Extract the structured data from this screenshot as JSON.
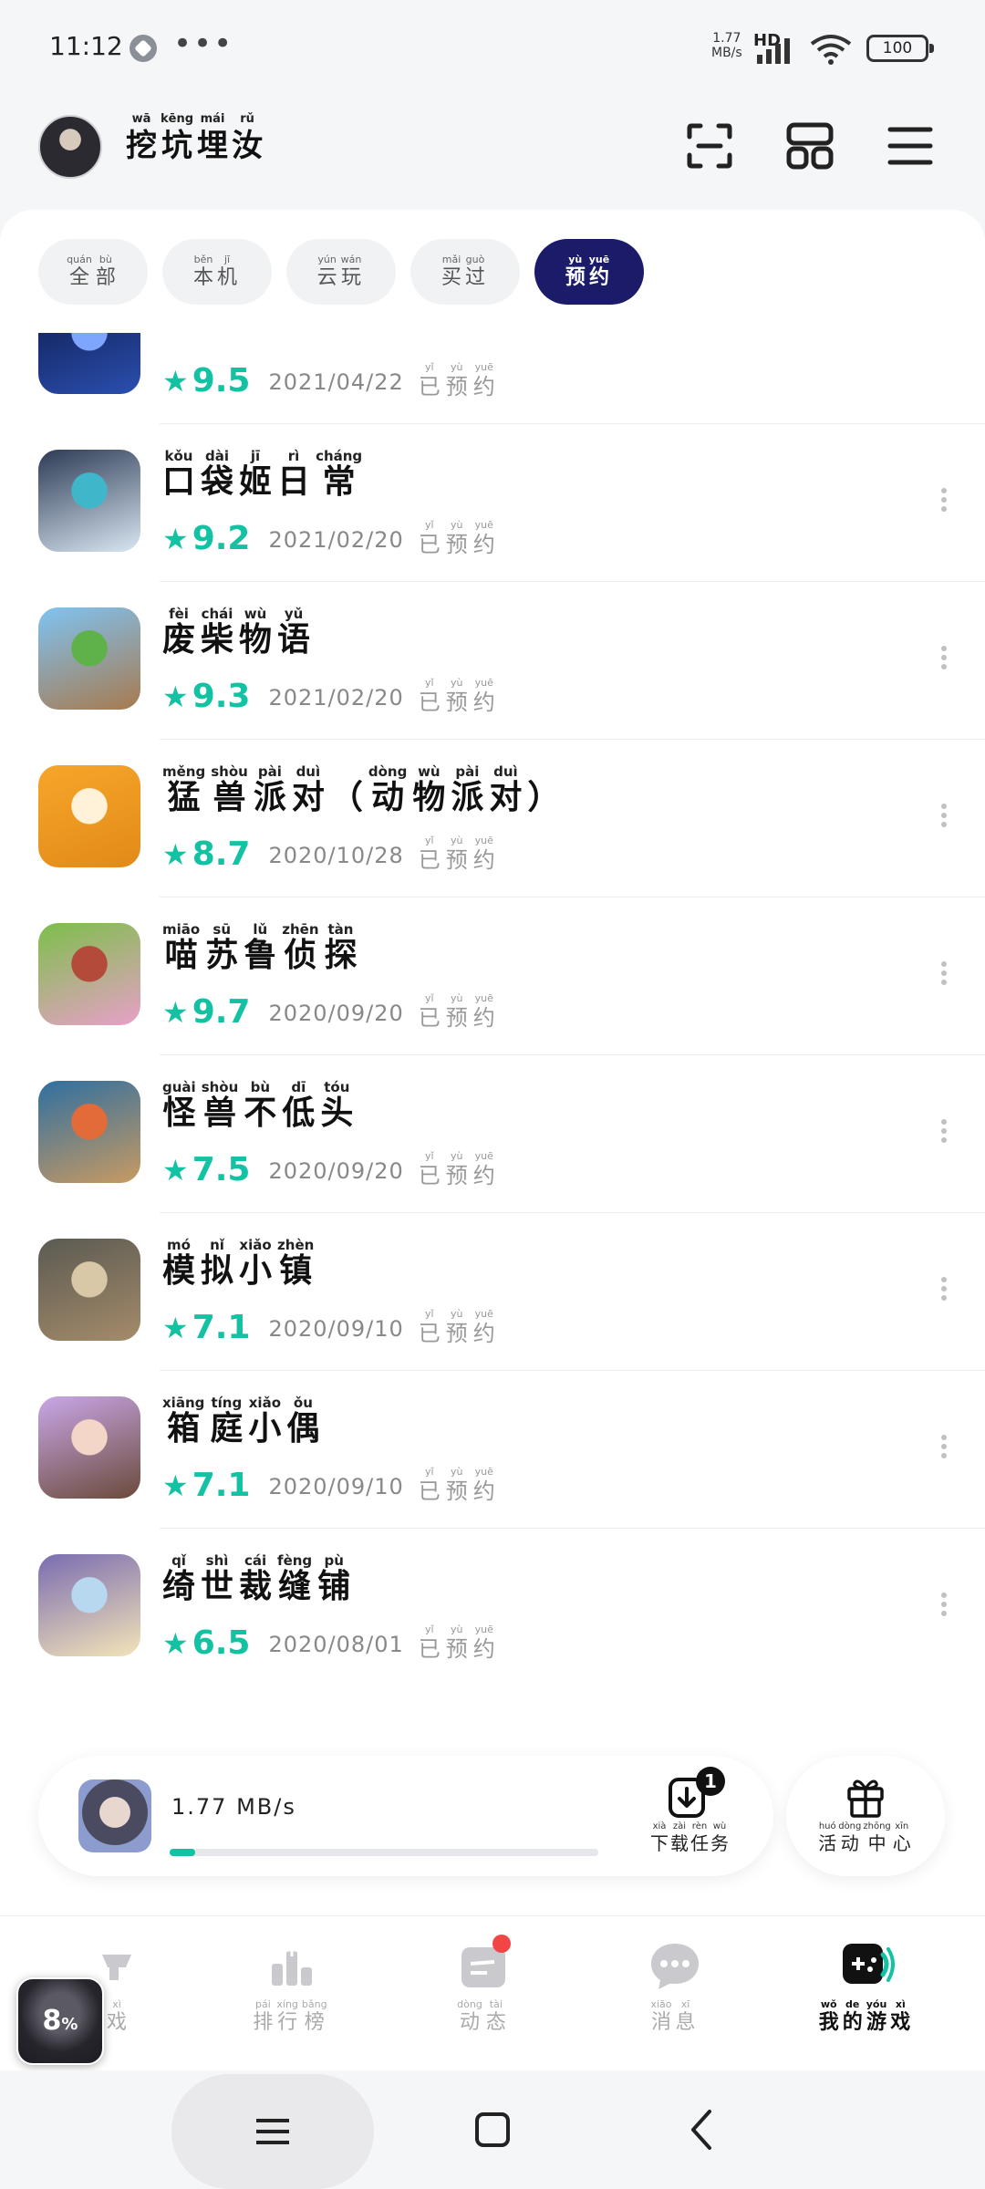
{
  "status": {
    "time": "11:12",
    "dots": "•••",
    "net_speed": "1.77",
    "net_unit": "MB/s",
    "hd": "HD",
    "battery": "100"
  },
  "header": {
    "username": [
      {
        "py": "wā",
        "hz": "挖"
      },
      {
        "py": "kēng",
        "hz": "坑"
      },
      {
        "py": "mái",
        "hz": "埋"
      },
      {
        "py": "rǔ",
        "hz": "汝"
      }
    ]
  },
  "tabs": [
    {
      "label": [
        {
          "py": "quán",
          "hz": "全"
        },
        {
          "py": "bù",
          "hz": "部"
        }
      ],
      "active": false
    },
    {
      "label": [
        {
          "py": "běn",
          "hz": "本"
        },
        {
          "py": "jī",
          "hz": "机"
        }
      ],
      "active": false
    },
    {
      "label": [
        {
          "py": "yún",
          "hz": "云"
        },
        {
          "py": "wán",
          "hz": "玩"
        }
      ],
      "active": false
    },
    {
      "label": [
        {
          "py": "mǎi",
          "hz": "买"
        },
        {
          "py": "guò",
          "hz": "过"
        }
      ],
      "active": false
    },
    {
      "label": [
        {
          "py": "yù",
          "hz": "预"
        },
        {
          "py": "yuē",
          "hz": "约"
        }
      ],
      "active": true
    }
  ],
  "reserved_label": [
    {
      "py": "yǐ",
      "hz": "已"
    },
    {
      "py": "yù",
      "hz": "预"
    },
    {
      "py": "yuē",
      "hz": "约"
    }
  ],
  "games": [
    {
      "title": [],
      "rating": "9.5",
      "date": "2021/04/22",
      "colors": [
        "#0c1a4a",
        "#2b4fb0",
        "#7fa6ff"
      ]
    },
    {
      "title": [
        {
          "py": "kǒu",
          "hz": "口"
        },
        {
          "py": "dài",
          "hz": "袋"
        },
        {
          "py": "jī",
          "hz": "姬"
        },
        {
          "py": "rì",
          "hz": "日"
        },
        {
          "py": "cháng",
          "hz": "常"
        }
      ],
      "rating": "9.2",
      "date": "2021/02/20",
      "colors": [
        "#2d3b55",
        "#d9e6f2",
        "#3fb6c9"
      ]
    },
    {
      "title": [
        {
          "py": "fèi",
          "hz": "废"
        },
        {
          "py": "chái",
          "hz": "柴"
        },
        {
          "py": "wù",
          "hz": "物"
        },
        {
          "py": "yǔ",
          "hz": "语"
        }
      ],
      "rating": "9.3",
      "date": "2021/02/20",
      "colors": [
        "#7fc3f2",
        "#a77a4f",
        "#5fb24a"
      ]
    },
    {
      "title": [
        {
          "py": "měng",
          "hz": "猛"
        },
        {
          "py": "shòu",
          "hz": "兽"
        },
        {
          "py": "pài",
          "hz": "派"
        },
        {
          "py": "duì",
          "hz": "对"
        },
        {
          "py": "",
          "hz": "（"
        },
        {
          "py": "dòng",
          "hz": "动"
        },
        {
          "py": "wù",
          "hz": "物"
        },
        {
          "py": "pài",
          "hz": "派"
        },
        {
          "py": "duì",
          "hz": "对"
        },
        {
          "py": "",
          "hz": "）"
        }
      ],
      "rating": "8.7",
      "date": "2020/10/28",
      "colors": [
        "#f6a62a",
        "#e28a18",
        "#fff2d8"
      ]
    },
    {
      "title": [
        {
          "py": "miāo",
          "hz": "喵"
        },
        {
          "py": "sū",
          "hz": "苏"
        },
        {
          "py": "lǔ",
          "hz": "鲁"
        },
        {
          "py": "zhēn",
          "hz": "侦"
        },
        {
          "py": "tàn",
          "hz": "探"
        }
      ],
      "rating": "9.7",
      "date": "2020/09/20",
      "colors": [
        "#7cbf4a",
        "#e8a0c8",
        "#b34a3a"
      ]
    },
    {
      "title": [
        {
          "py": "guài",
          "hz": "怪"
        },
        {
          "py": "shòu",
          "hz": "兽"
        },
        {
          "py": "bù",
          "hz": "不"
        },
        {
          "py": "dī",
          "hz": "低"
        },
        {
          "py": "tóu",
          "hz": "头"
        }
      ],
      "rating": "7.5",
      "date": "2020/09/20",
      "colors": [
        "#2f6fa0",
        "#c89a62",
        "#e36b3a"
      ]
    },
    {
      "title": [
        {
          "py": "mó",
          "hz": "模"
        },
        {
          "py": "nǐ",
          "hz": "拟"
        },
        {
          "py": "xiǎo",
          "hz": "小"
        },
        {
          "py": "zhèn",
          "hz": "镇"
        }
      ],
      "rating": "7.1",
      "date": "2020/09/10",
      "colors": [
        "#5a5a52",
        "#a58b6a",
        "#d8c8a8"
      ]
    },
    {
      "title": [
        {
          "py": "xiāng",
          "hz": "箱"
        },
        {
          "py": "tíng",
          "hz": "庭"
        },
        {
          "py": "xiǎo",
          "hz": "小"
        },
        {
          "py": "ǒu",
          "hz": "偶"
        }
      ],
      "rating": "7.1",
      "date": "2020/09/10",
      "colors": [
        "#c9a7e8",
        "#6a4a3a",
        "#f3d6c8"
      ]
    },
    {
      "title": [
        {
          "py": "qǐ",
          "hz": "绮"
        },
        {
          "py": "shì",
          "hz": "世"
        },
        {
          "py": "cái",
          "hz": "裁"
        },
        {
          "py": "fèng",
          "hz": "缝"
        },
        {
          "py": "pù",
          "hz": "铺"
        }
      ],
      "rating": "6.5",
      "date": "2020/08/01",
      "colors": [
        "#7a6cb0",
        "#f3e4b8",
        "#b8d8f0"
      ]
    }
  ],
  "download": {
    "speed": "1.77 MB/s",
    "progress_fraction": 0.06,
    "task_badge": "1",
    "task_label": [
      {
        "py": "xià",
        "hz": "下"
      },
      {
        "py": "zài",
        "hz": "载"
      },
      {
        "py": "rèn",
        "hz": "任"
      },
      {
        "py": "wù",
        "hz": "务"
      }
    ],
    "event_label": [
      {
        "py": "huó",
        "hz": "活"
      },
      {
        "py": "dòng",
        "hz": "动"
      },
      {
        "py": "zhōng",
        "hz": "中"
      },
      {
        "py": "xīn",
        "hz": "心"
      }
    ]
  },
  "nav": [
    {
      "name": "games",
      "label": [
        {
          "py": "xì",
          "hz": "戏"
        }
      ],
      "active": false
    },
    {
      "name": "rank",
      "label": [
        {
          "py": "pái",
          "hz": "排"
        },
        {
          "py": "xíng",
          "hz": "行"
        },
        {
          "py": "bǎng",
          "hz": "榜"
        }
      ],
      "active": false
    },
    {
      "name": "feed",
      "label": [
        {
          "py": "dòng",
          "hz": "动"
        },
        {
          "py": "tài",
          "hz": "态"
        }
      ],
      "active": false
    },
    {
      "name": "messages",
      "label": [
        {
          "py": "xiāo",
          "hz": "消"
        },
        {
          "py": "xī",
          "hz": "息"
        }
      ],
      "active": false
    },
    {
      "name": "my-games",
      "label": [
        {
          "py": "wǒ",
          "hz": "我"
        },
        {
          "py": "de",
          "hz": "的"
        },
        {
          "py": "yóu",
          "hz": "游"
        },
        {
          "py": "xì",
          "hz": "戏"
        }
      ],
      "active": true
    }
  ],
  "floating": {
    "percent": "8",
    "unit": "%"
  },
  "colors": {
    "accent": "#13c2a3",
    "tab_active": "#1b1b6a",
    "badge_red": "#f24545"
  }
}
